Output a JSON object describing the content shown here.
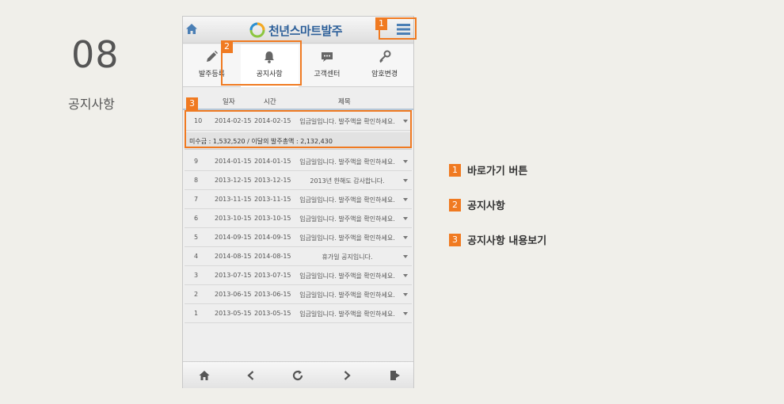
{
  "step": {
    "number": "08",
    "title": "공지사항"
  },
  "app": {
    "brand_name": "천년스마트발주"
  },
  "tabs": [
    {
      "label": "발주등록",
      "icon": "pencil-icon"
    },
    {
      "label": "공지사항",
      "icon": "bell-icon"
    },
    {
      "label": "고객센터",
      "icon": "chat-icon"
    },
    {
      "label": "암호변경",
      "icon": "key-icon"
    }
  ],
  "table": {
    "headers": {
      "date": "일자",
      "time": "시간",
      "subject": "제목"
    },
    "rows": [
      {
        "no": "10",
        "date": "2014-02-15",
        "time": "2014-02-15",
        "subject": "입금일입니다. 발주액을 확인하세요."
      },
      {
        "no": "9",
        "date": "2014-01-15",
        "time": "2014-01-15",
        "subject": "입금일입니다. 발주액을 확인하세요."
      },
      {
        "no": "8",
        "date": "2013-12-15",
        "time": "2013-12-15",
        "subject": "2013년 한해도 감사합니다."
      },
      {
        "no": "7",
        "date": "2013-11-15",
        "time": "2013-11-15",
        "subject": "입금일입니다. 발주액을 확인하세요."
      },
      {
        "no": "6",
        "date": "2013-10-15",
        "time": "2013-10-15",
        "subject": "입금일입니다. 발주액을 확인하세요."
      },
      {
        "no": "5",
        "date": "2014-09-15",
        "time": "2014-09-15",
        "subject": "입금일입니다. 발주액을 확인하세요."
      },
      {
        "no": "4",
        "date": "2014-08-15",
        "time": "2014-08-15",
        "subject": "휴가일 공지입니다."
      },
      {
        "no": "3",
        "date": "2013-07-15",
        "time": "2013-07-15",
        "subject": "입금일입니다. 발주액을 확인하세요."
      },
      {
        "no": "2",
        "date": "2013-06-15",
        "time": "2013-06-15",
        "subject": "입금일입니다. 발주액을 확인하세요."
      },
      {
        "no": "1",
        "date": "2013-05-15",
        "time": "2013-05-15",
        "subject": "입금일입니다. 발주액을 확인하세요."
      }
    ],
    "detail": "미수금 : 1,532,520   /   이달의 발주총액 : 2,132,430"
  },
  "bottom_nav": [
    "home-icon",
    "back-icon",
    "refresh-icon",
    "forward-icon",
    "logout-icon"
  ],
  "callouts": [
    {
      "num": "1",
      "label": "바로가기 버튼"
    },
    {
      "num": "2",
      "label": "공지사항"
    },
    {
      "num": "3",
      "label": "공지사항 내용보기"
    }
  ],
  "colors": {
    "accent": "#f07a21",
    "brand": "#2c5f99"
  }
}
